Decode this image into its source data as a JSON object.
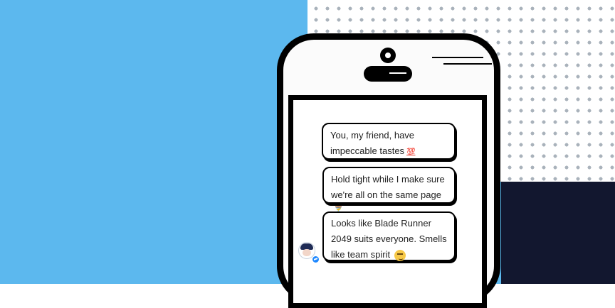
{
  "colors": {
    "background_blue": "#5cb8ee",
    "dot_pattern": "#a9b2bb",
    "navy_block": "#12172f",
    "phone_body": "#fbfbfb",
    "outline": "#000000"
  },
  "chat": {
    "messages": [
      {
        "text": "You, my friend, have impeccable tastes",
        "emoji": "💯",
        "emoji_name": "hundred-points"
      },
      {
        "text": "Hold tight while I make sure we're all on the same page",
        "emoji": "⏳",
        "emoji_name": "hourglass"
      },
      {
        "text": "Looks like Blade Runner 2049 suits everyone. Smells like team spirit",
        "emoji": "😏",
        "emoji_name": "smirk"
      }
    ],
    "avatar": {
      "icon": "bot-avatar-icon",
      "badge_icon": "messenger-icon"
    }
  }
}
